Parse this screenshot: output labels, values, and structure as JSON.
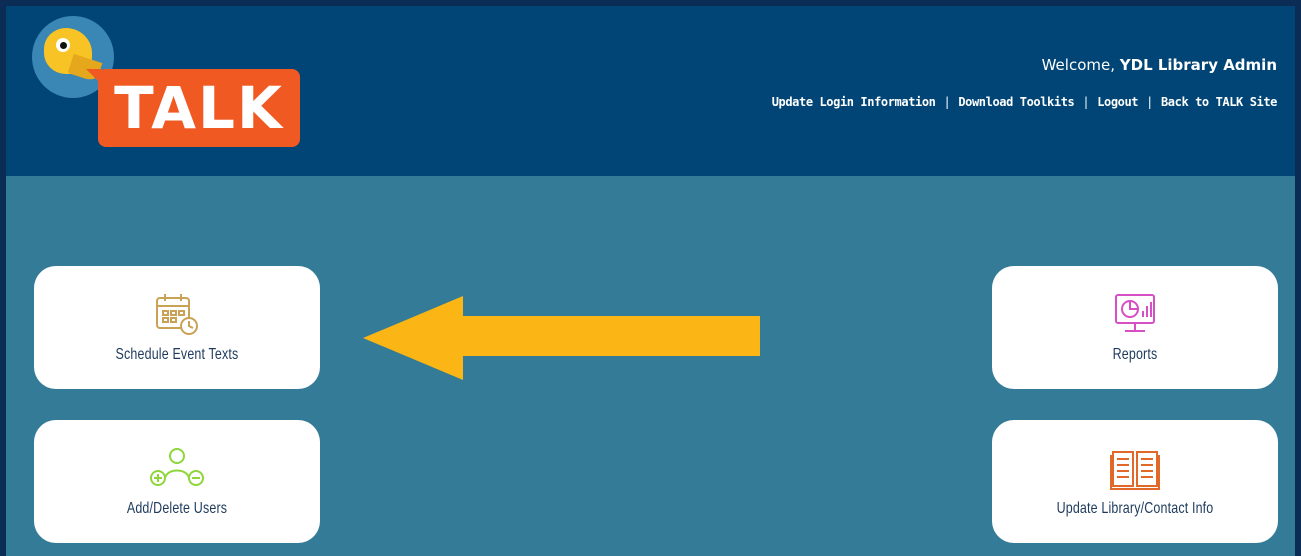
{
  "logo": {
    "text": "TALK"
  },
  "header": {
    "welcome_prefix": "Welcome, ",
    "user_name": "YDL Library Admin",
    "links": [
      "Update Login Information",
      "Download Toolkits",
      "Logout",
      "Back to TALK Site"
    ]
  },
  "cards": {
    "schedule": {
      "label": "Schedule Event Texts",
      "icon": "calendar-clock-icon",
      "color": "#c9a255"
    },
    "users": {
      "label": "Add/Delete Users",
      "icon": "add-remove-users-icon",
      "color": "#8ed63a"
    },
    "reports": {
      "label": "Reports",
      "icon": "monitor-chart-icon",
      "color": "#d64fc5"
    },
    "library": {
      "label": "Update Library/Contact Info",
      "icon": "open-book-icon",
      "color": "#e0692a"
    }
  },
  "annotation": {
    "arrow_color": "#fbb615"
  }
}
